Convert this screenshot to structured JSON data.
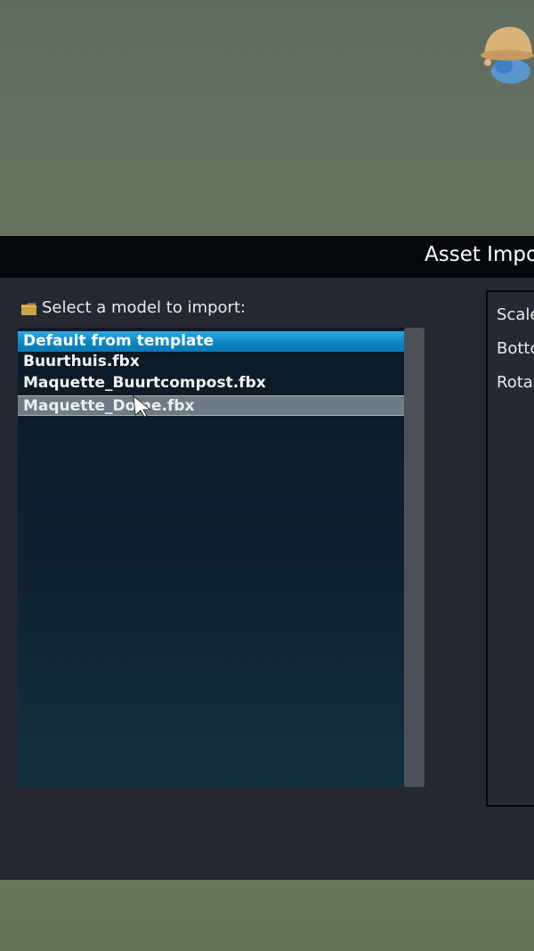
{
  "dialog": {
    "title": "Asset Impo",
    "select_label": "Select a model to import:",
    "folder_icon": "folder-icon"
  },
  "model_list": {
    "items": [
      {
        "label": "Default from template",
        "state": "selected"
      },
      {
        "label": "Buurthuis.fbx",
        "state": "normal"
      },
      {
        "label": "Maquette_Buurtcompost.fbx",
        "state": "normal"
      },
      {
        "label": "Maquette_Dome.fbx",
        "state": "hovered"
      }
    ]
  },
  "properties": {
    "labels": [
      "Scale",
      "Botto",
      "Rota"
    ]
  },
  "colors": {
    "titlebar": "#05080c",
    "dialog_bg": "#232831",
    "selection": "#0b86c4",
    "hover": "#6d7c84",
    "scene": "#626f5e"
  }
}
